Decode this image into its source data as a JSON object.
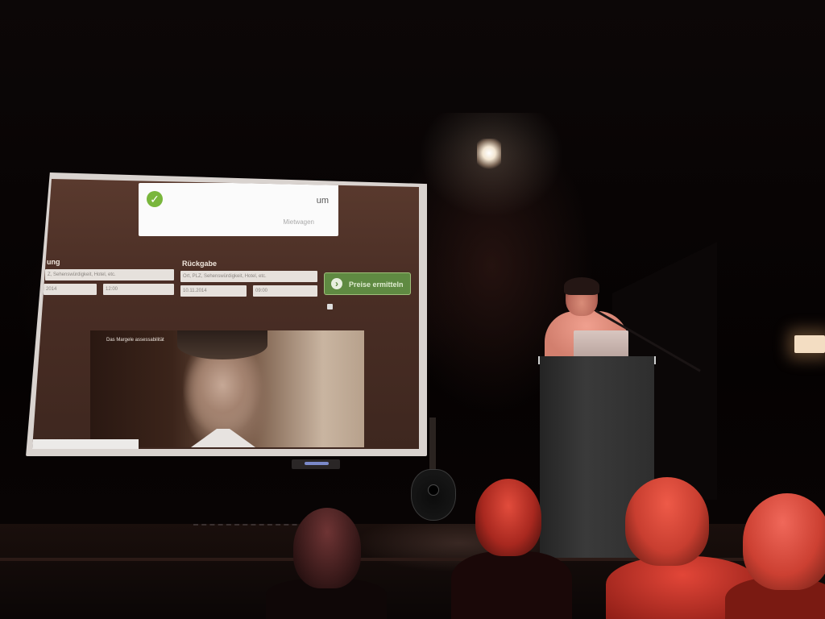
{
  "projection": {
    "logo_tld": "um",
    "logo_sub": "Mietwagen",
    "labels": {
      "pickup": "ung",
      "return": "Rückgabe"
    },
    "fields": {
      "pickup_location": "Z, Sehenswürdigkeit, Hotel, etc.",
      "pickup_date": "2014",
      "pickup_time": "12:00",
      "return_location": "Ort, PLZ, Sehenswürdigkeit, Hotel, etc.",
      "return_date": "10.11.2014",
      "return_time": "09:00"
    },
    "price_button_label": "Preise ermitteln",
    "photo_caption": "Das Margele assessabilität"
  },
  "colors": {
    "screen_background": "#4a2e25",
    "button_green": "#5f8a42",
    "audience_red": "#cc4032"
  }
}
